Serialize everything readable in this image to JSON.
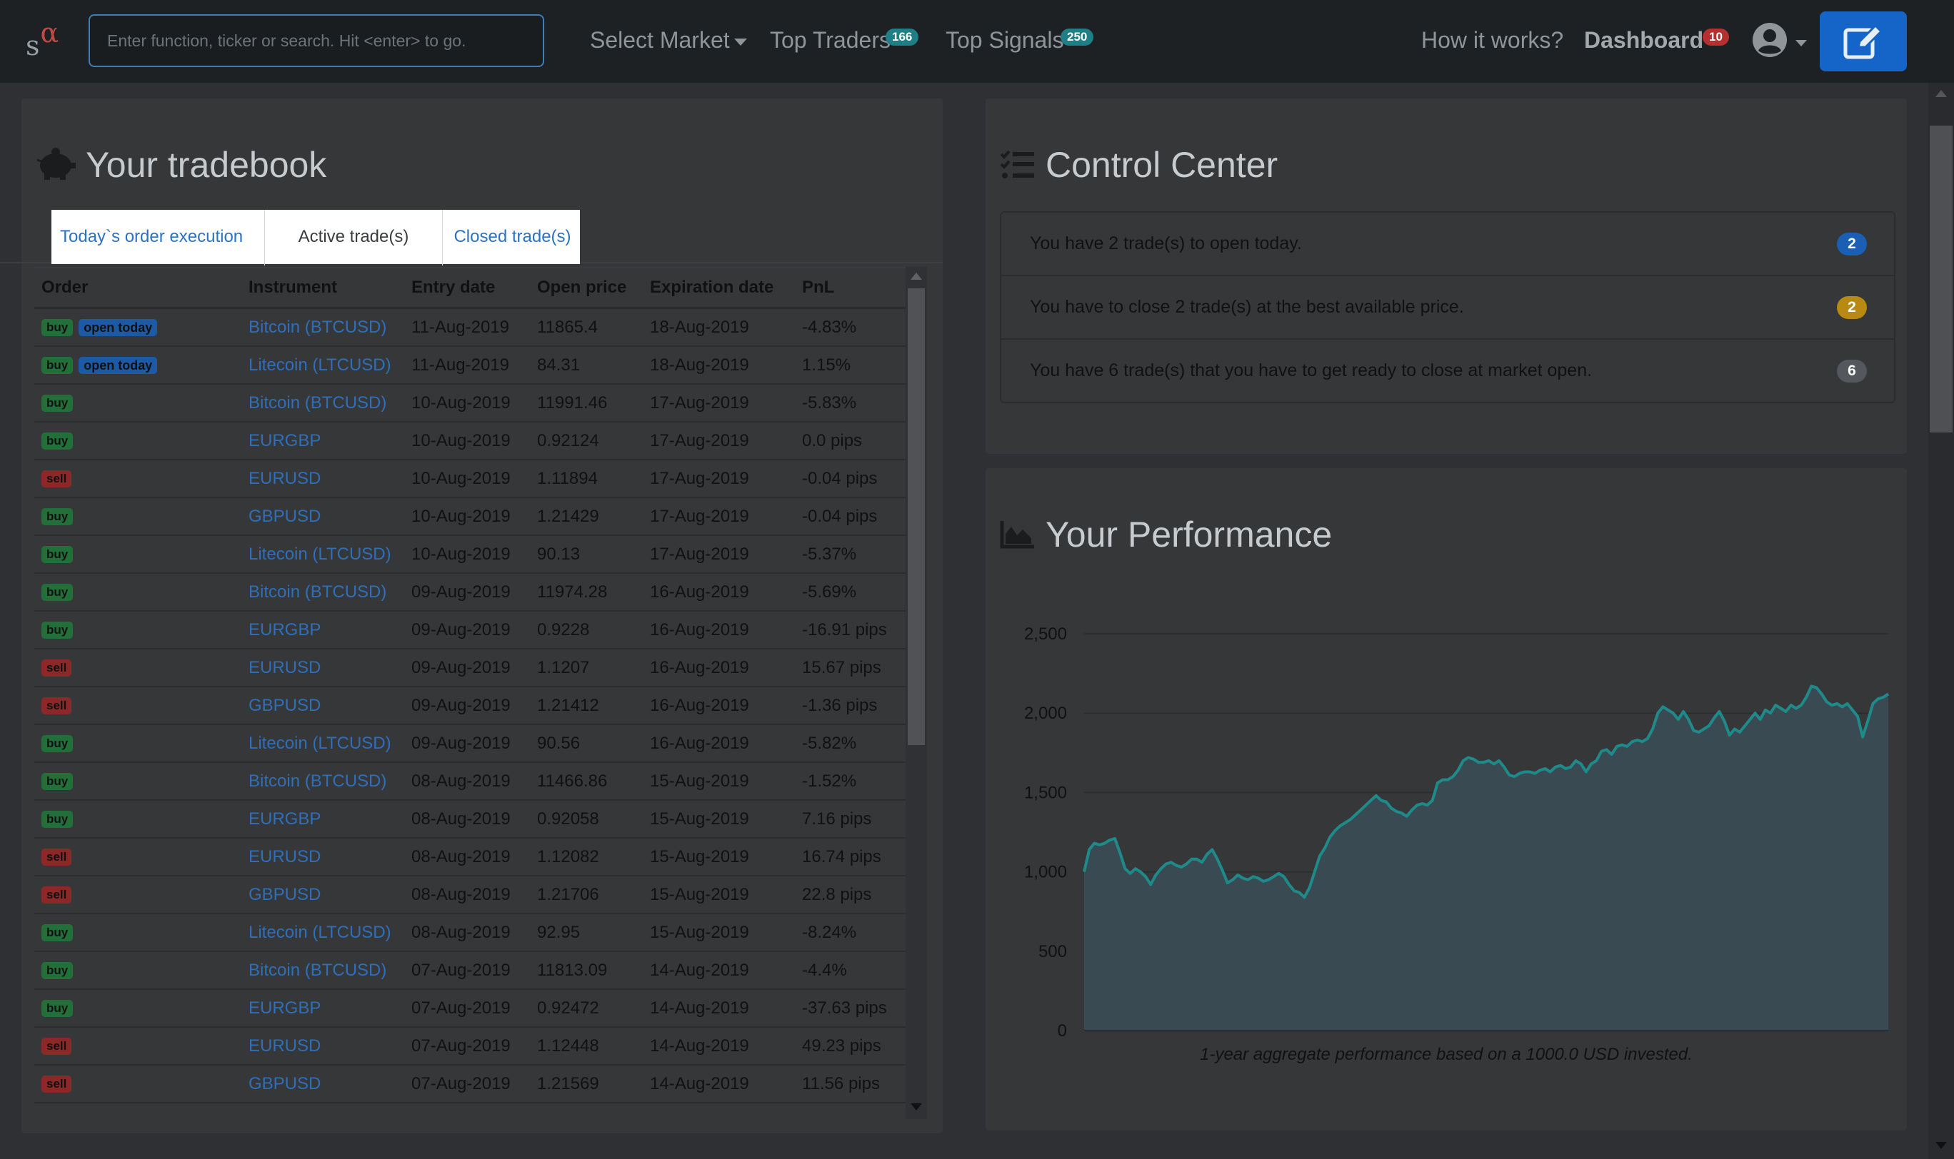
{
  "navbar": {
    "brand_s": "s",
    "brand_alpha": "α",
    "search_placeholder": "Enter function, ticker or search. Hit <enter> to go.",
    "select_market": "Select Market",
    "top_traders": "Top Traders",
    "top_traders_count": "166",
    "top_signals": "Top Signals",
    "top_signals_count": "250",
    "how_it_works": "How it works?",
    "dashboard": "Dashboard",
    "dashboard_count": "10",
    "user_icon": "user-circle-icon",
    "compose_icon": "edit-icon"
  },
  "tradebook": {
    "title": "Your tradebook",
    "icon": "piggy-bank-icon",
    "tabs": [
      "Today`s order execution",
      "Active trade(s)",
      "Closed trade(s)"
    ],
    "active_tab": "Active trade(s)",
    "columns": [
      "Order",
      "Instrument",
      "Entry date",
      "Open price",
      "Expiration date",
      "PnL"
    ],
    "open_today_label": "open today",
    "rows": [
      {
        "side": "buy",
        "today": true,
        "instrument": "Bitcoin (BTCUSD)",
        "entry": "11-Aug-2019",
        "open": "11865.4",
        "expiry": "18-Aug-2019",
        "pnl": "-4.83%",
        "pos": false
      },
      {
        "side": "buy",
        "today": true,
        "instrument": "Litecoin (LTCUSD)",
        "entry": "11-Aug-2019",
        "open": "84.31",
        "expiry": "18-Aug-2019",
        "pnl": "1.15%",
        "pos": true
      },
      {
        "side": "buy",
        "today": false,
        "instrument": "Bitcoin (BTCUSD)",
        "entry": "10-Aug-2019",
        "open": "11991.46",
        "expiry": "17-Aug-2019",
        "pnl": "-5.83%",
        "pos": false
      },
      {
        "side": "buy",
        "today": false,
        "instrument": "EURGBP",
        "entry": "10-Aug-2019",
        "open": "0.92124",
        "expiry": "17-Aug-2019",
        "pnl": "0.0 pips",
        "pos": true
      },
      {
        "side": "sell",
        "today": false,
        "instrument": "EURUSD",
        "entry": "10-Aug-2019",
        "open": "1.11894",
        "expiry": "17-Aug-2019",
        "pnl": "-0.04 pips",
        "pos": false
      },
      {
        "side": "buy",
        "today": false,
        "instrument": "GBPUSD",
        "entry": "10-Aug-2019",
        "open": "1.21429",
        "expiry": "17-Aug-2019",
        "pnl": "-0.04 pips",
        "pos": false
      },
      {
        "side": "buy",
        "today": false,
        "instrument": "Litecoin (LTCUSD)",
        "entry": "10-Aug-2019",
        "open": "90.13",
        "expiry": "17-Aug-2019",
        "pnl": "-5.37%",
        "pos": false
      },
      {
        "side": "buy",
        "today": false,
        "instrument": "Bitcoin (BTCUSD)",
        "entry": "09-Aug-2019",
        "open": "11974.28",
        "expiry": "16-Aug-2019",
        "pnl": "-5.69%",
        "pos": false
      },
      {
        "side": "buy",
        "today": false,
        "instrument": "EURGBP",
        "entry": "09-Aug-2019",
        "open": "0.9228",
        "expiry": "16-Aug-2019",
        "pnl": "-16.91 pips",
        "pos": false
      },
      {
        "side": "sell",
        "today": false,
        "instrument": "EURUSD",
        "entry": "09-Aug-2019",
        "open": "1.1207",
        "expiry": "16-Aug-2019",
        "pnl": "15.67 pips",
        "pos": true
      },
      {
        "side": "sell",
        "today": false,
        "instrument": "GBPUSD",
        "entry": "09-Aug-2019",
        "open": "1.21412",
        "expiry": "16-Aug-2019",
        "pnl": "-1.36 pips",
        "pos": false
      },
      {
        "side": "buy",
        "today": false,
        "instrument": "Litecoin (LTCUSD)",
        "entry": "09-Aug-2019",
        "open": "90.56",
        "expiry": "16-Aug-2019",
        "pnl": "-5.82%",
        "pos": false
      },
      {
        "side": "buy",
        "today": false,
        "instrument": "Bitcoin (BTCUSD)",
        "entry": "08-Aug-2019",
        "open": "11466.86",
        "expiry": "15-Aug-2019",
        "pnl": "-1.52%",
        "pos": false
      },
      {
        "side": "buy",
        "today": false,
        "instrument": "EURGBP",
        "entry": "08-Aug-2019",
        "open": "0.92058",
        "expiry": "15-Aug-2019",
        "pnl": "7.16 pips",
        "pos": true
      },
      {
        "side": "sell",
        "today": false,
        "instrument": "EURUSD",
        "entry": "08-Aug-2019",
        "open": "1.12082",
        "expiry": "15-Aug-2019",
        "pnl": "16.74 pips",
        "pos": true
      },
      {
        "side": "sell",
        "today": false,
        "instrument": "GBPUSD",
        "entry": "08-Aug-2019",
        "open": "1.21706",
        "expiry": "15-Aug-2019",
        "pnl": "22.8 pips",
        "pos": true
      },
      {
        "side": "buy",
        "today": false,
        "instrument": "Litecoin (LTCUSD)",
        "entry": "08-Aug-2019",
        "open": "92.95",
        "expiry": "15-Aug-2019",
        "pnl": "-8.24%",
        "pos": false
      },
      {
        "side": "buy",
        "today": false,
        "instrument": "Bitcoin (BTCUSD)",
        "entry": "07-Aug-2019",
        "open": "11813.09",
        "expiry": "14-Aug-2019",
        "pnl": "-4.4%",
        "pos": false
      },
      {
        "side": "buy",
        "today": false,
        "instrument": "EURGBP",
        "entry": "07-Aug-2019",
        "open": "0.92472",
        "expiry": "14-Aug-2019",
        "pnl": "-37.63 pips",
        "pos": false
      },
      {
        "side": "sell",
        "today": false,
        "instrument": "EURUSD",
        "entry": "07-Aug-2019",
        "open": "1.12448",
        "expiry": "14-Aug-2019",
        "pnl": "49.23 pips",
        "pos": true
      },
      {
        "side": "sell",
        "today": false,
        "instrument": "GBPUSD",
        "entry": "07-Aug-2019",
        "open": "1.21569",
        "expiry": "14-Aug-2019",
        "pnl": "11.56 pips",
        "pos": true
      }
    ]
  },
  "control_center": {
    "title": "Control Center",
    "icon": "tasks-list-icon",
    "items": [
      {
        "text": "You have 2 trade(s) to open today.",
        "count": "2",
        "color": "#1a5fb4"
      },
      {
        "text": "You have to close 2 trade(s) at the best available price.",
        "count": "2",
        "color": "#b88a12"
      },
      {
        "text": "You have 6 trade(s) that you have to get ready to close at market open.",
        "count": "6",
        "color": "#54575b"
      }
    ]
  },
  "performance": {
    "title": "Your Performance",
    "icon": "area-chart-icon",
    "caption": "1-year aggregate performance based on a 1000.0 USD invested."
  },
  "chart_data": {
    "type": "area",
    "title": "",
    "xlabel": "",
    "ylabel": "",
    "ylim": [
      0,
      2500
    ],
    "yticks": [
      0,
      500,
      1000,
      1500,
      2000,
      2500
    ],
    "grid": true,
    "color": "#1f8a8a",
    "series": [
      {
        "values": [
          1000,
          1140,
          1180,
          1170,
          1180,
          1200,
          1210,
          1120,
          1020,
          990,
          1020,
          1000,
          970,
          920,
          980,
          1020,
          1050,
          1060,
          1040,
          1030,
          1050,
          1080,
          1080,
          1060,
          1110,
          1140,
          1080,
          1010,
          930,
          950,
          980,
          960,
          950,
          970,
          960,
          940,
          950,
          970,
          990,
          970,
          920,
          880,
          870,
          840,
          900,
          1000,
          1100,
          1150,
          1220,
          1260,
          1290,
          1310,
          1330,
          1360,
          1390,
          1420,
          1450,
          1480,
          1450,
          1440,
          1400,
          1380,
          1370,
          1350,
          1390,
          1420,
          1430,
          1420,
          1450,
          1560,
          1580,
          1580,
          1600,
          1640,
          1700,
          1720,
          1710,
          1690,
          1690,
          1700,
          1680,
          1700,
          1660,
          1610,
          1600,
          1620,
          1630,
          1630,
          1620,
          1640,
          1650,
          1630,
          1660,
          1670,
          1650,
          1660,
          1700,
          1680,
          1630,
          1680,
          1700,
          1760,
          1770,
          1740,
          1790,
          1800,
          1790,
          1820,
          1830,
          1820,
          1840,
          1900,
          2000,
          2040,
          2020,
          2000,
          1960,
          2010,
          1960,
          1890,
          1880,
          1900,
          1920,
          1970,
          2010,
          1950,
          1860,
          1900,
          1880,
          1920,
          1960,
          2000,
          1960,
          2020,
          2000,
          2050,
          2030,
          2010,
          2050,
          2030,
          2050,
          2100,
          2170,
          2160,
          2120,
          2070,
          2050,
          2060,
          2040,
          2060,
          2020,
          1980,
          1850,
          1950,
          2060,
          2090,
          2100,
          2120
        ]
      }
    ]
  }
}
